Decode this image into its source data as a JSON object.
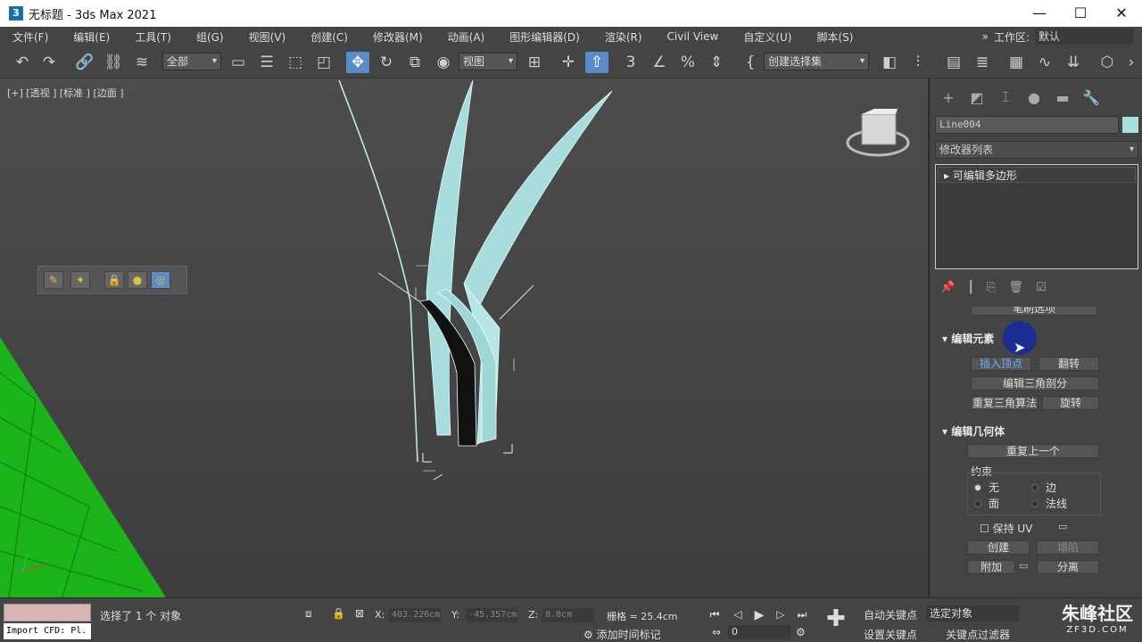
{
  "window": {
    "title": "无标题 - 3ds Max 2021",
    "app_icon": "3"
  },
  "menu": [
    "文件(F)",
    "编辑(E)",
    "工具(T)",
    "组(G)",
    "视图(V)",
    "创建(C)",
    "修改器(M)",
    "动画(A)",
    "图形编辑器(D)",
    "渲染(R)",
    "Civil View",
    "自定义(U)",
    "脚本(S)"
  ],
  "workspace": {
    "label": "工作区:",
    "value": "默认"
  },
  "toolbar": {
    "filter": "全部",
    "ref_coord": "视图",
    "selection_set": "创建选择集"
  },
  "viewport": {
    "label": "[+] [透视 ] [标准 ] [边面 ]"
  },
  "command_panel": {
    "object_name": "Line004",
    "modifier_list": "修改器列表",
    "stack_item": "可编辑多边形",
    "partial_rollout": "笔刷选项",
    "edit_elements": {
      "title": "编辑元素",
      "insert_vertex": "插入顶点",
      "flip": "翻转",
      "edit_tri": "编辑三角剖分",
      "retri": "重复三角算法",
      "turn": "旋转"
    },
    "edit_geometry": {
      "title": "编辑几何体",
      "repeat_last": "重复上一个",
      "constraints": "约束",
      "c_none": "无",
      "c_edge": "边",
      "c_face": "面",
      "c_normal": "法线",
      "preserve_uv": "保持 UV",
      "create": "创建",
      "collapse": "塌陷",
      "attach": "附加",
      "detach": "分离"
    }
  },
  "status": {
    "script_input": "Import CFD: Pl.",
    "selection": "选择了 1 个 对象",
    "x_label": "X:",
    "x_value": "403.226cm",
    "y_label": "Y:",
    "y_value": "-45.357cm",
    "z_label": "Z:",
    "z_value": "0.0cm",
    "grid": "栅格 = 25.4cm",
    "add_time_tag": "添加时间标记",
    "auto_key": "自动关键点",
    "set_key": "设置关键点",
    "selected_obj": "选定对象",
    "key_filters": "关键点过滤器",
    "frame": "0"
  },
  "watermark": {
    "brand": "朱峰社区",
    "url": "ZF3D.COM"
  }
}
